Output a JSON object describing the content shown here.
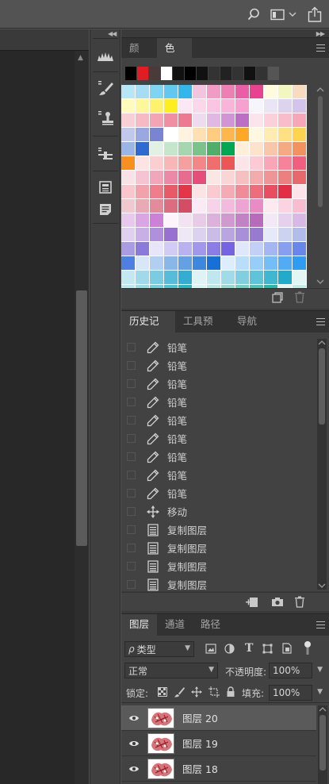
{
  "topbar": {
    "icons": [
      "search-icon",
      "workspace-icon",
      "chevron-down-icon",
      "share-icon"
    ]
  },
  "colors": {
    "bg_canvas": "#282828",
    "panel": "#424242",
    "tab_bar": "#323232",
    "selected_row": "#5a5a5a"
  },
  "swatches_panel": {
    "tabs": [
      {
        "label": "颜色",
        "active": false
      },
      {
        "label": "色板",
        "active": true
      }
    ],
    "recent": [
      "#000000",
      "#e21c23",
      "#4a3a3a",
      "#ffffff",
      "#111111",
      "#000000",
      "#111111",
      "#333333",
      "#222222",
      "#333333",
      "#111111",
      "#333333",
      "#555555"
    ],
    "grid": [
      [
        "#b7e6f7",
        "#a7dcf5",
        "#7fd3f3",
        "#62c8ef",
        "#33b7eb",
        "#f3c4df",
        "#f19bc7",
        "#ee7fb5",
        "#ea5ea6",
        "#e8438f",
        "#fffbdc",
        "#f2f7c0",
        "#f7dcc0"
      ],
      [
        "#fffbbc",
        "#fff79b",
        "#fff36d",
        "#fcee21",
        "#fce8f4",
        "#fbd7eb",
        "#fac5e2",
        "#f8b4d9",
        "#f6a1cf",
        "#f5f5fb",
        "#e9e5f6",
        "#dcd3ef",
        "#d2c4ea"
      ],
      [
        "#f8cfd7",
        "#f6bac5",
        "#f4a5b5",
        "#f08fa3",
        "#ee7a91",
        "#eedbf0",
        "#dfb9e2",
        "#cf95d4",
        "#bc6ec5",
        "#fce4ec",
        "#fbd0db",
        "#f9bccb",
        "#f6a7ba"
      ],
      [
        "#c1c8ec",
        "#9ba7e0",
        "#7785d3",
        "#ffffff",
        "#fff3e0",
        "#ffe0b2",
        "#ffcc80",
        "#ffb74d",
        "#ffa726",
        "#fff8e1",
        "#ffecb3",
        "#ffe082",
        "#ffd54f"
      ],
      [
        "#9ab5e6",
        "#2e6bd1",
        "#e1f2e4",
        "#c5e6cb",
        "#a5d6af",
        "#7bc28b",
        "#4fae6a",
        "#00a651",
        "#ffeed8",
        "#fde2cc",
        "#f8c6a8",
        "#f5aa82",
        "#f2925f"
      ],
      [
        "#f7901e",
        "#fde3e3",
        "#fbcfcf",
        "#f8b7b7",
        "#f69f9f",
        "#f38787",
        "#f06e6e",
        "#ed5656",
        "#fde4e9",
        "#fccad5",
        "#f9a6b8",
        "#f6839b",
        "#f25f7e"
      ],
      [
        "#f8e1e7",
        "#f4c4d2",
        "#f0a7bc",
        "#ec89a6",
        "#e86c90",
        "#e44f7a",
        "#fbe6e6",
        "#f9d5d5",
        "#f6c0c0",
        "#f3abab",
        "#ef9595",
        "#ec7f7f",
        "#e86969"
      ],
      [
        "#f8c6cc",
        "#f3a2ab",
        "#ee7e8a",
        "#e95a69",
        "#e43648",
        "#fce4e4",
        "#f9cbd0",
        "#f5abb4",
        "#f08c98",
        "#ec6d7c",
        "#e84e60",
        "#e22f45",
        "#fde4ea"
      ],
      [
        "#f0c9d0",
        "#eaaab5",
        "#e38b9a",
        "#dc6c7f",
        "#d54d64",
        "#fbeaf5",
        "#f7d3ea",
        "#f2bbde",
        "#eea4d2",
        "#e98cc6",
        "#fde9f0",
        "#fbd3e1",
        "#f9bdd2"
      ],
      [
        "#e9c8ee",
        "#dba4e3",
        "#cd80d8",
        "#fdf3fb",
        "#f3e3f2",
        "#e8cbe7",
        "#dcb2dc",
        "#d09ad1",
        "#c482c6",
        "#b86abb",
        "#f3e8f6",
        "#e5d0ee",
        "#d8b8e5"
      ],
      [
        "#e0d0f0",
        "#c8b0e6",
        "#b090dc",
        "#9870d2",
        "#ede7f6",
        "#dcd2ef",
        "#cbbce7",
        "#b9a6e0",
        "#a890d8",
        "#977bd0",
        "#e6e9f8",
        "#ccd3f1",
        "#b3bdea"
      ],
      [
        "#a99ce3",
        "#8a7ad9",
        "#e8e5fa",
        "#d1cbf5",
        "#bab1f0",
        "#a397eb",
        "#8c7de6",
        "#7563e1",
        "#e1e7fb",
        "#c3cff7",
        "#a5b7f3",
        "#879fee",
        "#6987ea"
      ],
      [
        "#4e7fe2",
        "#d8e7f8",
        "#b1cff1",
        "#8ab7ea",
        "#64a0e3",
        "#3d88dc",
        "#1670d5",
        "#dceefd",
        "#b9defb",
        "#97cdf9",
        "#74bdf7",
        "#52acf5",
        "#2f9cf3"
      ],
      [
        "#c3e8f2",
        "#9fd9ea",
        "#7bcbe2",
        "#57bcda",
        "#33aed2",
        "#dff3f7",
        "#bfe7f0",
        "#9fdbe8",
        "#7fcfe0",
        "#5fc3d9",
        "#3fb7d1",
        "#1fabc9",
        "#e3f6f6"
      ],
      [
        "#b6ecf1",
        "#8fe0e8",
        "#69d4df",
        "#42c8d6",
        "#1cbccd",
        "#d9f4f1",
        "#b3e9e3",
        "#8ddfd5",
        "#67d4c7",
        "#41c9b9",
        "#1bbeab",
        "#e0f7f3",
        "#c1efe7"
      ],
      [
        "#a3e6db",
        "#84decf",
        "#65d6c3",
        "#46ceb7",
        "#e6f9f2",
        "#ccf3e5",
        "#b3edd9",
        "#99e7cc",
        "#80e1bf",
        "#66dbb2",
        "#00a651",
        "#e7f8ea",
        "#cff1d5"
      ]
    ]
  },
  "history_panel": {
    "tabs": [
      {
        "label": "历史记录",
        "active": true
      },
      {
        "label": "工具预设",
        "active": false
      },
      {
        "label": "导航器",
        "active": false
      }
    ],
    "items": [
      {
        "label": "铅笔",
        "icon": "pencil-icon"
      },
      {
        "label": "铅笔",
        "icon": "pencil-icon"
      },
      {
        "label": "铅笔",
        "icon": "pencil-icon"
      },
      {
        "label": "铅笔",
        "icon": "pencil-icon"
      },
      {
        "label": "铅笔",
        "icon": "pencil-icon"
      },
      {
        "label": "铅笔",
        "icon": "pencil-icon"
      },
      {
        "label": "铅笔",
        "icon": "pencil-icon"
      },
      {
        "label": "铅笔",
        "icon": "pencil-icon"
      },
      {
        "label": "铅笔",
        "icon": "pencil-icon"
      },
      {
        "label": "移动",
        "icon": "move-icon"
      },
      {
        "label": "复制图层",
        "icon": "document-icon"
      },
      {
        "label": "复制图层",
        "icon": "document-icon"
      },
      {
        "label": "复制图层",
        "icon": "document-icon"
      },
      {
        "label": "复制图层",
        "icon": "document-icon"
      }
    ]
  },
  "layers_panel": {
    "tabs": [
      {
        "label": "图层",
        "active": true
      },
      {
        "label": "通道",
        "active": false
      },
      {
        "label": "路径",
        "active": false
      }
    ],
    "filter": {
      "prefix": "ρ",
      "value": "类型"
    },
    "blend_mode": "正常",
    "opacity_label": "不透明度:",
    "opacity_value": "100%",
    "lock_label": "锁定:",
    "fill_label": "填充:",
    "fill_value": "100%",
    "layers": [
      {
        "name": "图层 20",
        "selected": true
      },
      {
        "name": "图层 19",
        "selected": false
      },
      {
        "name": "图层 18",
        "selected": false
      }
    ]
  }
}
